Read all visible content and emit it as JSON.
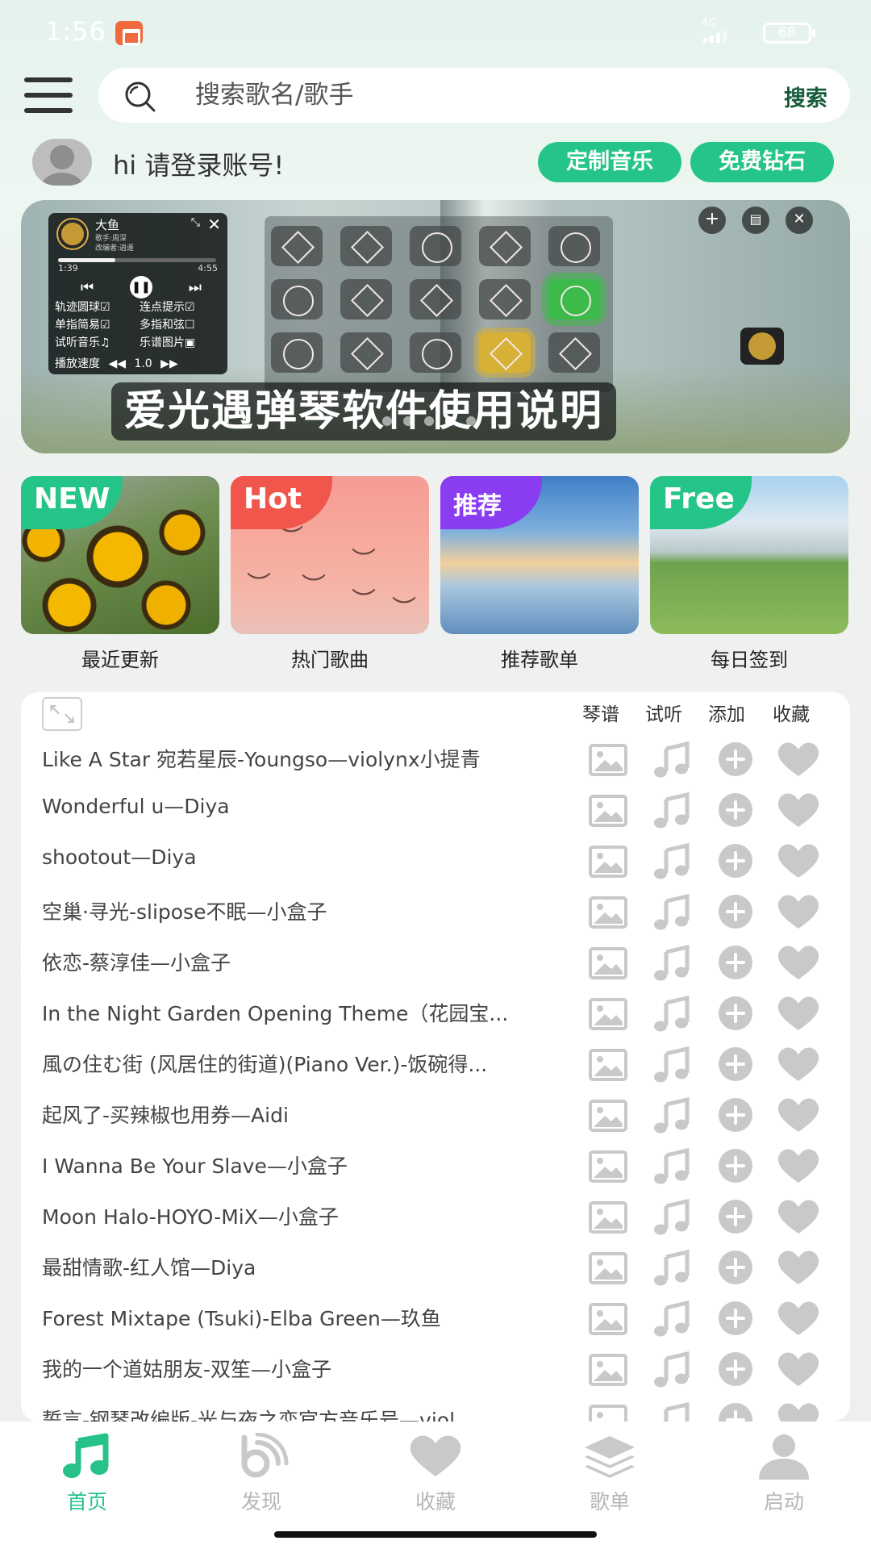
{
  "status_bar": {
    "time": "1:56",
    "network": "4G",
    "battery": "68"
  },
  "search": {
    "placeholder": "搜索歌名/歌手",
    "button": "搜索"
  },
  "user": {
    "greeting": "hi 请登录账号!"
  },
  "actions": {
    "custom_music": "定制音乐",
    "free_diamonds": "免费钻石"
  },
  "banner": {
    "caption": "爱光遇弹琴软件使用说明",
    "player": {
      "title": "大鱼",
      "singer": "歌手:周深",
      "arranger": "改编者:逍遥",
      "time_current": "1:39",
      "time_total": "4:55",
      "progress": 0.36,
      "options": [
        "轨迹圆球☑",
        "连点提示☑",
        "单指简易☑",
        "多指和弦☐",
        "试听音乐♫",
        "乐谱图片▣"
      ],
      "speed_label": "播放速度",
      "speed_value": "1.0"
    }
  },
  "categories": [
    {
      "tag": "NEW",
      "label": "最近更新",
      "tag_color": "#25c488"
    },
    {
      "tag": "Hot",
      "label": "热门歌曲",
      "tag_color": "#f0564c"
    },
    {
      "tag": "推荐",
      "label": "推荐歌单",
      "tag_color": "#8a3cf0"
    },
    {
      "tag": "Free",
      "label": "每日签到",
      "tag_color": "#25c488"
    }
  ],
  "song_list": {
    "columns": [
      "琴谱",
      "试听",
      "添加",
      "收藏"
    ],
    "songs": [
      "Like A Star 宛若星辰-Youngso—violynx小提青",
      "Wonderful u—Diya",
      "shootout—Diya",
      "空巢·寻光-slipose不眠—小盒子",
      "依恋-蔡淳佳—小盒子",
      "In the Night Garden Opening Theme（花园宝...",
      "風の住む街 (风居住的街道)(Piano Ver.)-饭碗得...",
      "起风了-买辣椒也用券—Aidi",
      "I Wanna Be Your Slave—小盒子",
      "Moon Halo-HOYO-MiX—小盒子",
      "最甜情歌-红人馆—Diya",
      "Forest Mixtape (Tsuki)-Elba Green—玖鱼",
      "我的一个道姑朋友-双笙—小盒子",
      "誓言-钢琴改编版-光与夜之恋官方音乐号—viol..."
    ]
  },
  "bottom_nav": [
    {
      "label": "首页",
      "icon": "music-note-icon",
      "active": true
    },
    {
      "label": "发现",
      "icon": "discover-icon",
      "active": false
    },
    {
      "label": "收藏",
      "icon": "heart-icon",
      "active": false
    },
    {
      "label": "歌单",
      "icon": "layers-icon",
      "active": false
    },
    {
      "label": "启动",
      "icon": "person-icon",
      "active": false
    }
  ],
  "colors": {
    "accent": "#25c488",
    "inactive_icon": "#c9c9c9",
    "search_button": "#155c3a"
  }
}
